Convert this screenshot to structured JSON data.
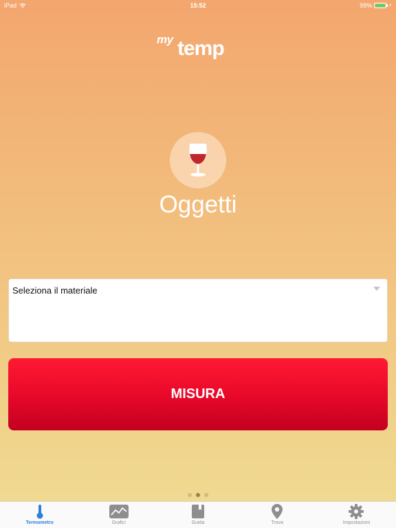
{
  "status_bar": {
    "device": "iPad",
    "time": "15:52",
    "battery": "99%",
    "battery_level": 0.99
  },
  "logo": {
    "my": "my",
    "temp": "temp"
  },
  "category": {
    "icon": "wine-glass-icon",
    "title": "Oggetti"
  },
  "material_select": {
    "selected": "Seleziona il materiale"
  },
  "measure_button": {
    "label": "MISURA"
  },
  "page_indicator": {
    "count": 3,
    "active_index": 1
  },
  "tab_bar": {
    "tabs": [
      {
        "label": "Termometro",
        "icon": "thermometer-icon",
        "active": true
      },
      {
        "label": "Grafici",
        "icon": "chart-icon",
        "active": false
      },
      {
        "label": "Guida",
        "icon": "book-icon",
        "active": false
      },
      {
        "label": "Trova",
        "icon": "location-pin-icon",
        "active": false
      },
      {
        "label": "Impostazioni",
        "icon": "gear-icon",
        "active": false
      }
    ]
  },
  "colors": {
    "accent_blue": "#2f7fd6",
    "measure_red": "#e9092a",
    "battery_green": "#4cd964"
  }
}
